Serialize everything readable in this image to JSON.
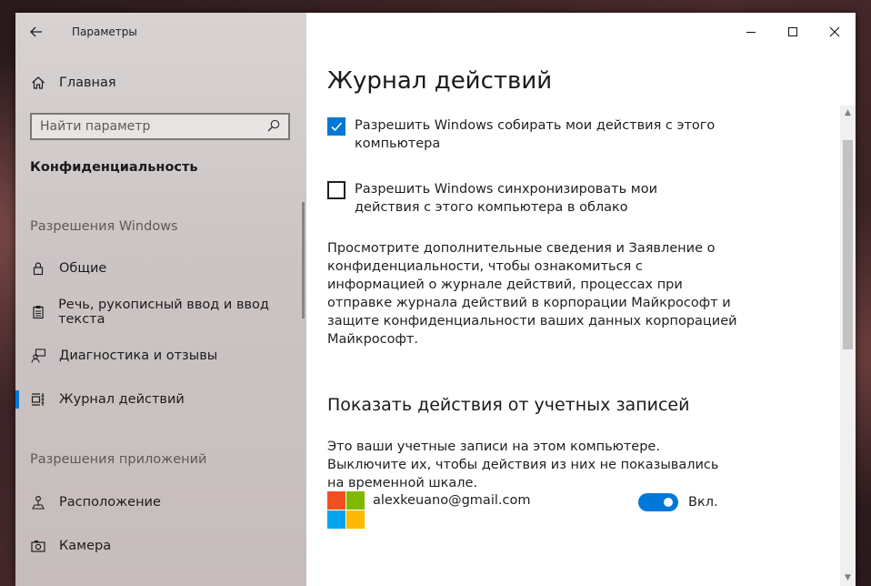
{
  "window": {
    "app_title": "Параметры",
    "back_glyph": "←",
    "minimize_glyph": "—",
    "maximize_glyph": "☐",
    "close_glyph": "✕"
  },
  "sidebar": {
    "home_label": "Главная",
    "search_placeholder": "Найти параметр",
    "current_section": "Конфиденциальность",
    "group1_header": "Разрешения Windows",
    "group2_header": "Разрешения приложений",
    "items": [
      {
        "label": "Общие",
        "icon": "lock-icon"
      },
      {
        "label": "Речь, рукописный ввод и ввод текста",
        "icon": "clipboard-icon"
      },
      {
        "label": "Диагностика и отзывы",
        "icon": "feedback-person-icon"
      },
      {
        "label": "Журнал действий",
        "icon": "timeline-icon",
        "selected": true
      },
      {
        "label": "Расположение",
        "icon": "location-icon"
      },
      {
        "label": "Камера",
        "icon": "camera-icon"
      }
    ]
  },
  "main": {
    "title": "Журнал действий",
    "checkbox_collect": {
      "label": "Разрешить Windows собирать мои действия с этого компьютера",
      "checked": true
    },
    "checkbox_sync": {
      "label": "Разрешить Windows синхронизировать мои действия с этого компьютера в облако",
      "checked": false
    },
    "privacy_text": "Просмотрите дополнительные сведения и Заявление о конфиденциальности, чтобы ознакомиться с информацией о журнале действий, процессах при отправке журнала действий в корпорации Майкрософт и защите конфиденциальности ваших данных корпорацией Майкрософт.",
    "accounts_heading": "Показать действия от учетных записей",
    "accounts_desc": "Это ваши учетные записи на этом компьютере. Выключите их, чтобы действия из них не показывались на временной шкале.",
    "account": {
      "email": "alexkeuano@gmail.com",
      "toggle_state_label": "Вкл.",
      "enabled": true
    }
  },
  "colors": {
    "accent": "#0078d7",
    "ms_red": "#f25022",
    "ms_green": "#7fba00",
    "ms_blue": "#00a4ef",
    "ms_yellow": "#ffb900"
  }
}
